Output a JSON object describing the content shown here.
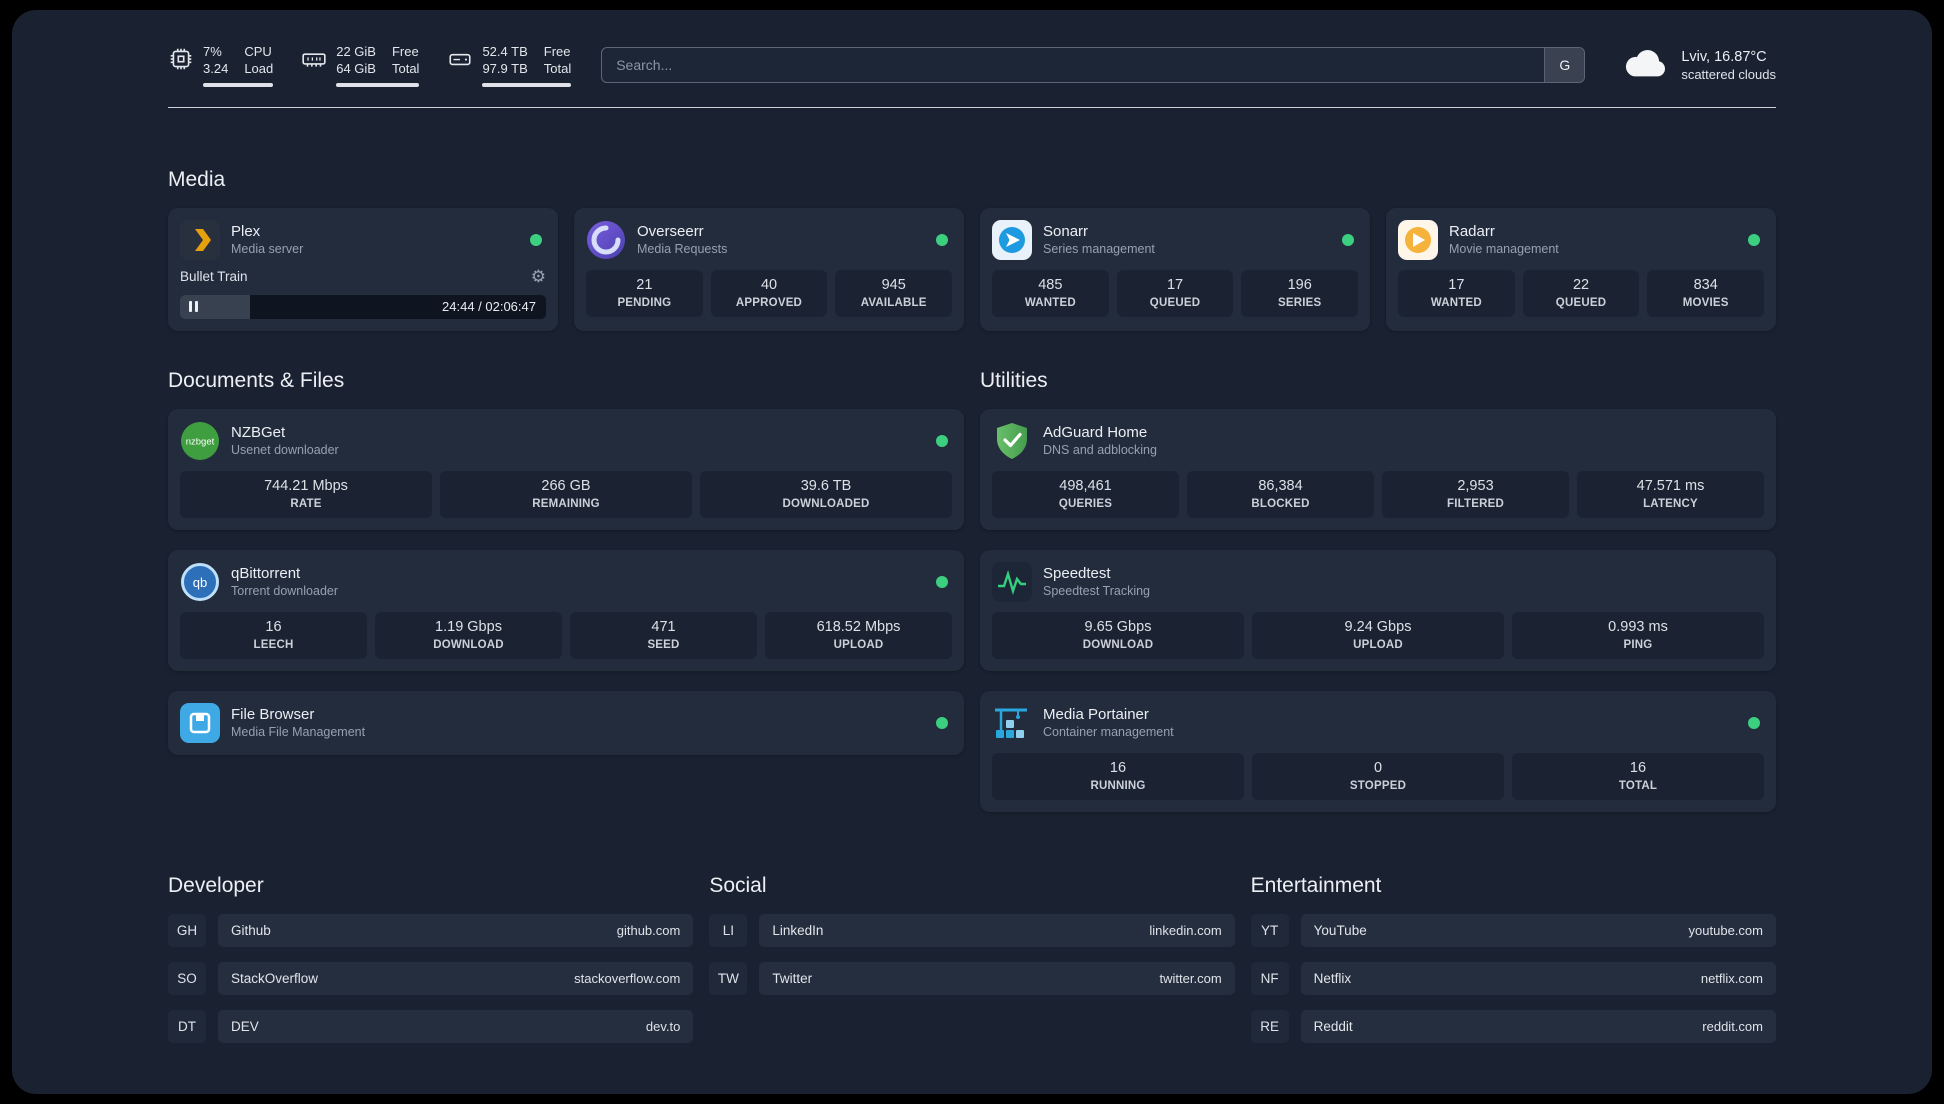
{
  "topbar": {
    "metrics": [
      {
        "icon": "cpu-icon",
        "value_top": "7%",
        "value_bottom": "3.24",
        "label_top": "CPU",
        "label_bottom": "Load"
      },
      {
        "icon": "ram-icon",
        "value_top": "22 GiB",
        "value_bottom": "64 GiB",
        "label_top": "Free",
        "label_bottom": "Total"
      },
      {
        "icon": "disk-icon",
        "value_top": "52.4 TB",
        "value_bottom": "97.9 TB",
        "label_top": "Free",
        "label_bottom": "Total"
      }
    ],
    "search": {
      "placeholder": "Search...",
      "engine_label": "G"
    },
    "weather": {
      "location": "Lviv, 16.87°C",
      "condition": "scattered clouds"
    }
  },
  "media": {
    "title": "Media",
    "plex": {
      "name": "Plex",
      "subtitle": "Media server",
      "now_playing": "Bullet Train",
      "time": "24:44 / 02:06:47"
    },
    "overseerr": {
      "name": "Overseerr",
      "subtitle": "Media Requests",
      "stats": [
        {
          "value": "21",
          "label": "PENDING"
        },
        {
          "value": "40",
          "label": "APPROVED"
        },
        {
          "value": "945",
          "label": "AVAILABLE"
        }
      ]
    },
    "sonarr": {
      "name": "Sonarr",
      "subtitle": "Series management",
      "stats": [
        {
          "value": "485",
          "label": "WANTED"
        },
        {
          "value": "17",
          "label": "QUEUED"
        },
        {
          "value": "196",
          "label": "SERIES"
        }
      ]
    },
    "radarr": {
      "name": "Radarr",
      "subtitle": "Movie management",
      "stats": [
        {
          "value": "17",
          "label": "WANTED"
        },
        {
          "value": "22",
          "label": "QUEUED"
        },
        {
          "value": "834",
          "label": "MOVIES"
        }
      ]
    }
  },
  "documents": {
    "title": "Documents & Files",
    "nzbget": {
      "name": "NZBGet",
      "subtitle": "Usenet downloader",
      "stats": [
        {
          "value": "744.21 Mbps",
          "label": "RATE"
        },
        {
          "value": "266 GB",
          "label": "REMAINING"
        },
        {
          "value": "39.6 TB",
          "label": "DOWNLOADED"
        }
      ]
    },
    "qbittorrent": {
      "name": "qBittorrent",
      "subtitle": "Torrent downloader",
      "stats": [
        {
          "value": "16",
          "label": "LEECH"
        },
        {
          "value": "1.19 Gbps",
          "label": "DOWNLOAD"
        },
        {
          "value": "471",
          "label": "SEED"
        },
        {
          "value": "618.52 Mbps",
          "label": "UPLOAD"
        }
      ]
    },
    "filebrowser": {
      "name": "File Browser",
      "subtitle": "Media File Management"
    }
  },
  "utilities": {
    "title": "Utilities",
    "adguard": {
      "name": "AdGuard Home",
      "subtitle": "DNS and adblocking",
      "stats": [
        {
          "value": "498,461",
          "label": "QUERIES"
        },
        {
          "value": "86,384",
          "label": "BLOCKED"
        },
        {
          "value": "2,953",
          "label": "FILTERED"
        },
        {
          "value": "47.571 ms",
          "label": "LATENCY"
        }
      ]
    },
    "speedtest": {
      "name": "Speedtest",
      "subtitle": "Speedtest Tracking",
      "stats": [
        {
          "value": "9.65 Gbps",
          "label": "DOWNLOAD"
        },
        {
          "value": "9.24 Gbps",
          "label": "UPLOAD"
        },
        {
          "value": "0.993 ms",
          "label": "PING"
        }
      ]
    },
    "portainer": {
      "name": "Media Portainer",
      "subtitle": "Container management",
      "stats": [
        {
          "value": "16",
          "label": "RUNNING"
        },
        {
          "value": "0",
          "label": "STOPPED"
        },
        {
          "value": "16",
          "label": "TOTAL"
        }
      ]
    }
  },
  "bookmarks": [
    {
      "title": "Developer",
      "links": [
        {
          "abbr": "GH",
          "name": "Github",
          "url": "github.com"
        },
        {
          "abbr": "SO",
          "name": "StackOverflow",
          "url": "stackoverflow.com"
        },
        {
          "abbr": "DT",
          "name": "DEV",
          "url": "dev.to"
        }
      ]
    },
    {
      "title": "Social",
      "links": [
        {
          "abbr": "LI",
          "name": "LinkedIn",
          "url": "linkedin.com"
        },
        {
          "abbr": "TW",
          "name": "Twitter",
          "url": "twitter.com"
        }
      ]
    },
    {
      "title": "Entertainment",
      "links": [
        {
          "abbr": "YT",
          "name": "YouTube",
          "url": "youtube.com"
        },
        {
          "abbr": "NF",
          "name": "Netflix",
          "url": "netflix.com"
        },
        {
          "abbr": "RE",
          "name": "Reddit",
          "url": "reddit.com"
        }
      ]
    }
  ],
  "colors": {
    "status_online": "#3ccf7f",
    "plex_amber": "#e5a00d",
    "background": "#1a2232",
    "card": "#232c3d"
  }
}
